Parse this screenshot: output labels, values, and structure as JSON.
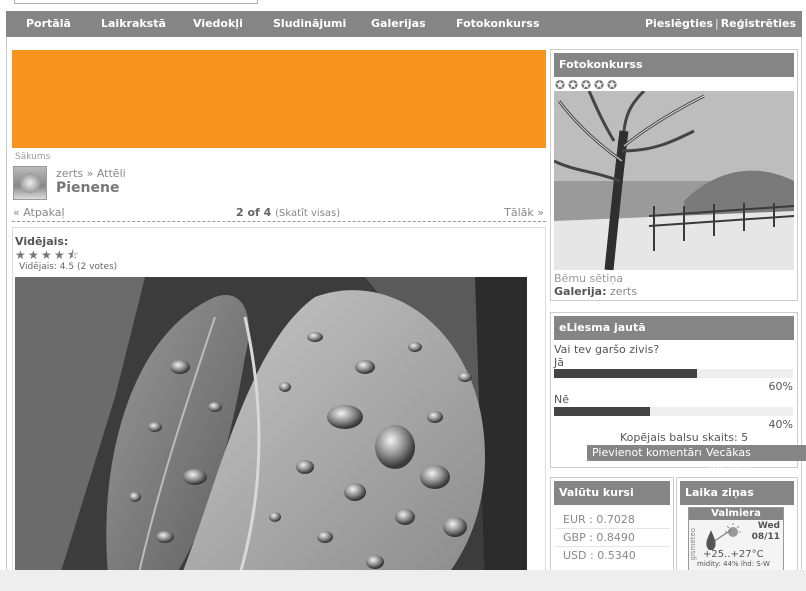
{
  "nav": {
    "items": [
      "Portālā",
      "Laikrakstā",
      "Viedokļi",
      "Sludinājumi",
      "Galerijas",
      "Fotokonkurss"
    ],
    "login": "Pieslēgties",
    "separator": "|",
    "register": "Reģistrēties"
  },
  "breadcrumb": "Sākums",
  "photo_page": {
    "owner": "zerts",
    "owner_sep": "»",
    "album": "Attēli",
    "title": "Pienene",
    "pager": {
      "prev": "« Atpakaļ",
      "position": "2 of 4",
      "view_all": "(Skatīt visas)",
      "next": "Tālāk »"
    },
    "rating": {
      "label": "Vidējais:",
      "summary": "Vidējais: 4.5 (2 votes)",
      "value": 4.5,
      "max": 5
    }
  },
  "fotokonkurss": {
    "header": "Fotokonkurss",
    "stars": 5,
    "image_title": "Bēmu sētiņa",
    "gallery_label": "Galerija:",
    "gallery_value": "zerts"
  },
  "poll": {
    "header": "eLiesma jautā",
    "question": "Vai tev garšo zivis?",
    "options": [
      {
        "label": "Jā",
        "percent": 60,
        "percent_text": "60%"
      },
      {
        "label": "Nē",
        "percent": 40,
        "percent_text": "40%"
      }
    ],
    "total": "Kopējais balsu skaits: 5",
    "comment_button": "Pievienot komentāru",
    "older_button": "Vecākas aptaujas"
  },
  "currency": {
    "header": "Valūtu kursi",
    "rates": [
      "EUR : 0.7028",
      "GBP : 0.8490",
      "USD : 0.5340"
    ]
  },
  "weather": {
    "header": "Laika ziņas",
    "city": "Valmiera",
    "day": "Wed",
    "date": "08/11",
    "temp": "+25..+27°C",
    "meta": "midity: 44% ihd: S-W",
    "brand": "gismeteo"
  },
  "colors": {
    "nav_bg": "#858585",
    "banner": "#f7941d",
    "poll_bar": "#444444"
  }
}
